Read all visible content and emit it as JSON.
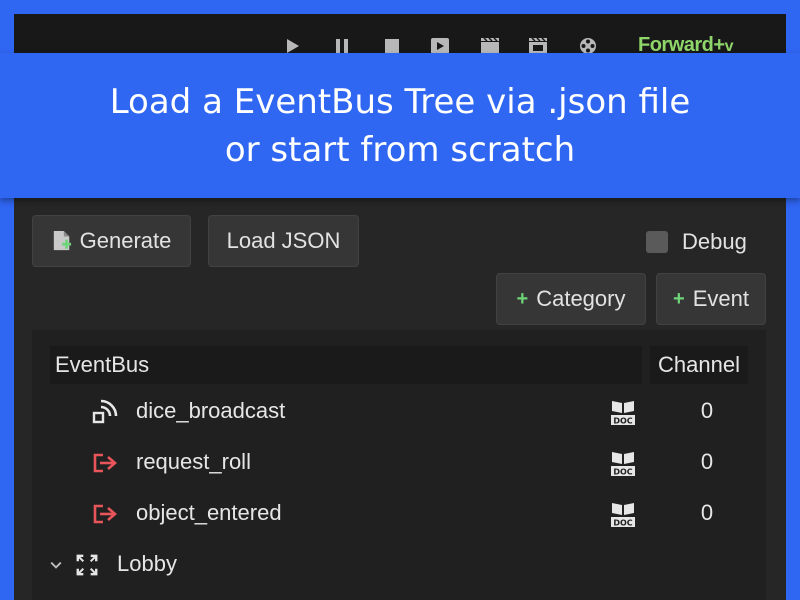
{
  "toolbar": {
    "icons": [
      "play-icon",
      "pause-icon",
      "stop-icon",
      "play-scene-icon",
      "play-custom-scene-icon",
      "movie-maker-icon",
      "film-reel-icon"
    ],
    "renderer_label": "Forward+",
    "renderer_chevron": "v"
  },
  "banner": {
    "line1": "Load a EventBus Tree via .json file",
    "line2": "or start from scratch"
  },
  "panel": {
    "generate_label": "Generate",
    "load_json_label": "Load JSON",
    "debug_label": "Debug",
    "debug_checked": false,
    "add_category_label": "Category",
    "add_event_label": "Event",
    "plus_symbol": "+"
  },
  "tree": {
    "col_eventbus": "EventBus",
    "col_channel": "Channel",
    "rows": [
      {
        "label": "dice_broadcast",
        "icon": "broadcast-icon",
        "channel": "0",
        "has_doc": true
      },
      {
        "label": "request_roll",
        "icon": "signal-out-icon",
        "channel": "0",
        "has_doc": true
      },
      {
        "label": "object_entered",
        "icon": "signal-out-icon",
        "channel": "0",
        "has_doc": true
      }
    ],
    "category": {
      "label": "Lobby",
      "icon": "expand-icon",
      "expanded": true
    }
  },
  "colors": {
    "background_blue": "#2f66f2",
    "renderer_green": "#8fd66a",
    "plus_green": "#6fd57a",
    "signal_red": "#e8555a"
  }
}
